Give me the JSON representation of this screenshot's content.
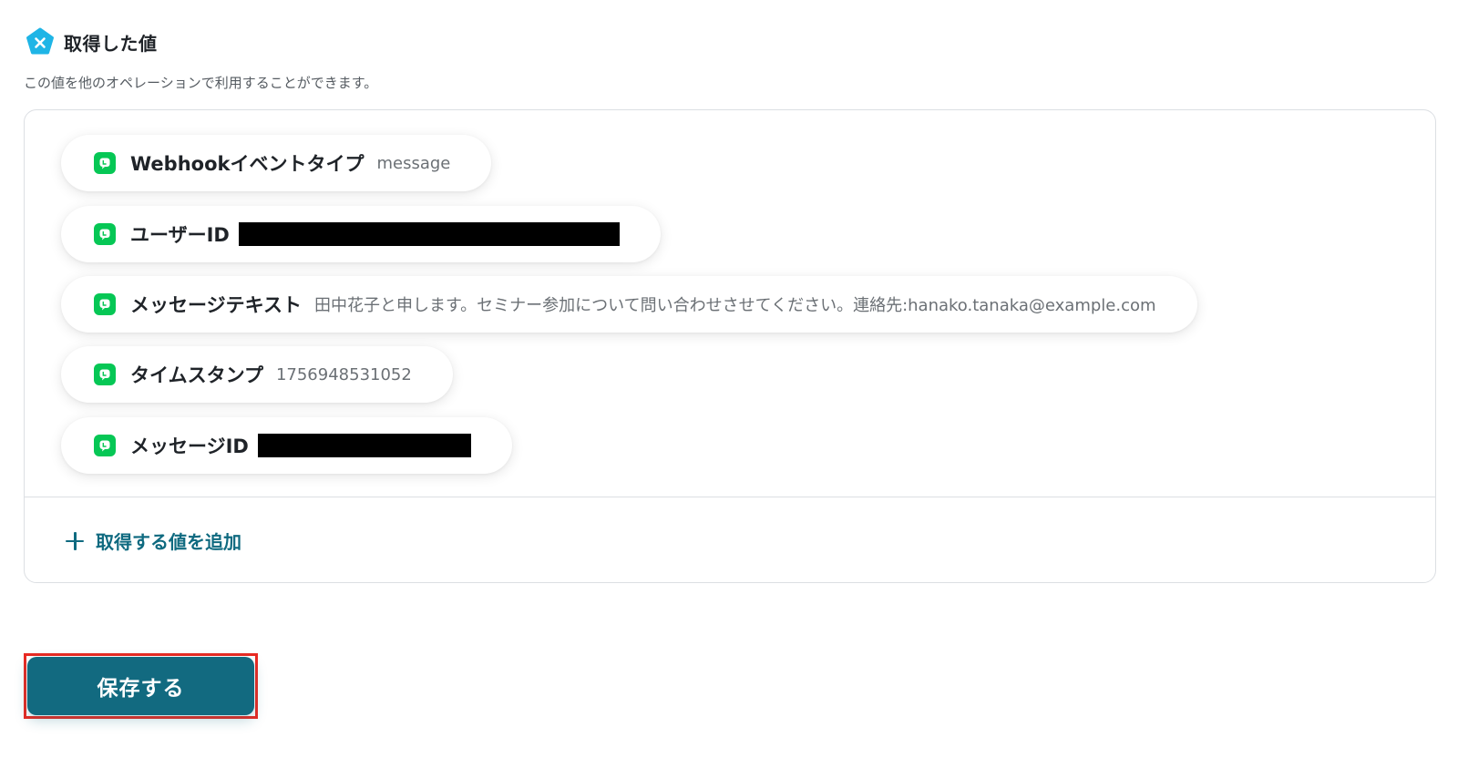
{
  "section": {
    "title": "取得した値",
    "description": "この値を他のオペレーションで利用することができます。",
    "icon": "variable-x-icon",
    "icon_color": "#1fb5e6"
  },
  "values": [
    {
      "label": "Webhookイベントタイプ",
      "value": "message",
      "redacted": false,
      "icon": "line-icon"
    },
    {
      "label": "ユーザーID",
      "value": "",
      "redacted": true,
      "icon": "line-icon"
    },
    {
      "label": "メッセージテキスト",
      "value": "田中花子と申します。セミナー参加について問い合わせさせてください。連絡先:hanako.tanaka@example.com",
      "redacted": false,
      "icon": "line-icon"
    },
    {
      "label": "タイムスタンプ",
      "value": "1756948531052",
      "redacted": false,
      "icon": "line-icon"
    },
    {
      "label": "メッセージID",
      "value": "",
      "redacted": true,
      "icon": "line-icon"
    }
  ],
  "add_value": {
    "label": "取得する値を追加",
    "icon": "plus-icon"
  },
  "save_button": {
    "label": "保存する"
  },
  "colors": {
    "accent": "#126a80",
    "link": "#0f6a80",
    "line_green": "#06c755",
    "highlight": "#ea2a22"
  }
}
